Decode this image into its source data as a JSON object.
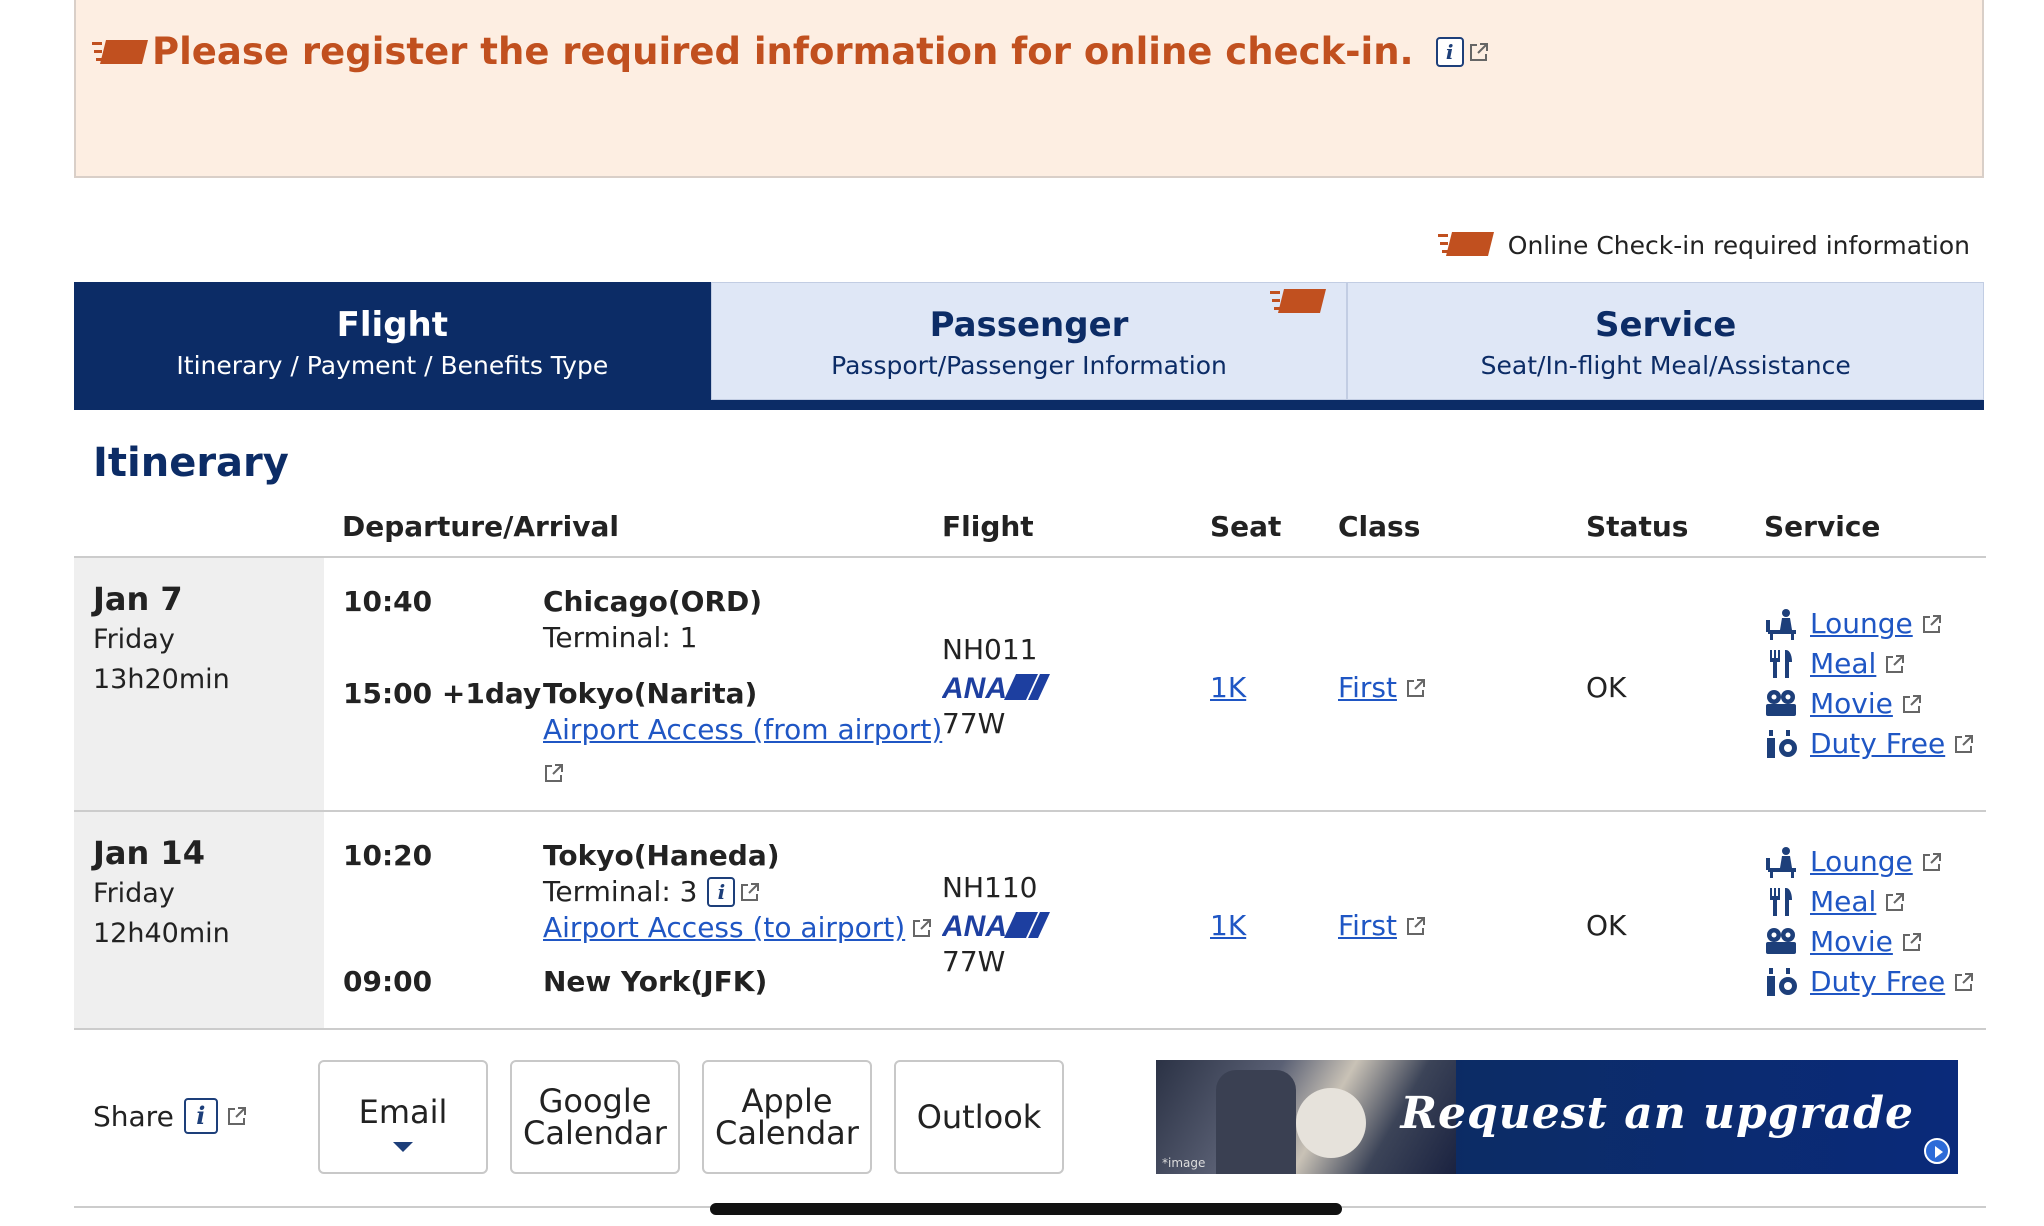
{
  "alert": {
    "message": "Please register the required information for online check-in."
  },
  "legend": {
    "label": "Online Check-in required information"
  },
  "tabs": [
    {
      "title": "Flight",
      "subtitle": "Itinerary / Payment / Benefits Type",
      "active": true
    },
    {
      "title": "Passenger",
      "subtitle": "Passport/Passenger Information",
      "active": false
    },
    {
      "title": "Service",
      "subtitle": "Seat/In-flight Meal/Assistance",
      "active": false
    }
  ],
  "itinerary": {
    "title": "Itinerary",
    "headers": {
      "dep_arr": "Departure/Arrival",
      "flight": "Flight",
      "seat": "Seat",
      "class": "Class",
      "status": "Status",
      "service": "Service"
    },
    "rows": [
      {
        "date": "Jan 7",
        "day": "Friday",
        "duration": "13h20min",
        "dep_time": "10:40",
        "dep_city": "Chicago(ORD)",
        "dep_terminal": "Terminal: 1",
        "arr_time": "15:00 +1day",
        "arr_city": "Tokyo(Narita)",
        "access_link": "Airport Access (from airport)",
        "flight_no": "NH011",
        "aircraft": "77W",
        "seat": "1K",
        "class": "First",
        "status": "OK",
        "services": [
          "Lounge",
          "Meal",
          "Movie",
          "Duty Free"
        ]
      },
      {
        "date": "Jan 14",
        "day": "Friday",
        "duration": "12h40min",
        "dep_time": "10:20",
        "dep_city": "Tokyo(Haneda)",
        "dep_terminal": "Terminal: 3",
        "access_link": "Airport Access (to airport)",
        "arr_time": "09:00",
        "arr_city": "New York(JFK)",
        "flight_no": "NH110",
        "aircraft": "77W",
        "seat": "1K",
        "class": "First",
        "status": "OK",
        "services": [
          "Lounge",
          "Meal",
          "Movie",
          "Duty Free"
        ]
      }
    ]
  },
  "share": {
    "label": "Share",
    "buttons": {
      "email": "Email",
      "google_1": "Google",
      "google_2": "Calendar",
      "apple_1": "Apple",
      "apple_2": "Calendar",
      "outlook": "Outlook"
    }
  },
  "banner": {
    "text": "Request an upgrade",
    "caption": "*image"
  },
  "colors": {
    "brand_navy": "#0c2c66",
    "alert_orange": "#c1501f",
    "alert_bg": "#fdeee2",
    "link_blue": "#1f56c4",
    "tab_inactive": "#dfe7f6"
  },
  "icons": {
    "required": "required-ticket-icon",
    "info": "info-icon",
    "external": "external-link-icon",
    "lounge": "lounge-icon",
    "meal": "meal-icon",
    "movie": "movie-icon",
    "duty_free": "duty-free-icon"
  }
}
